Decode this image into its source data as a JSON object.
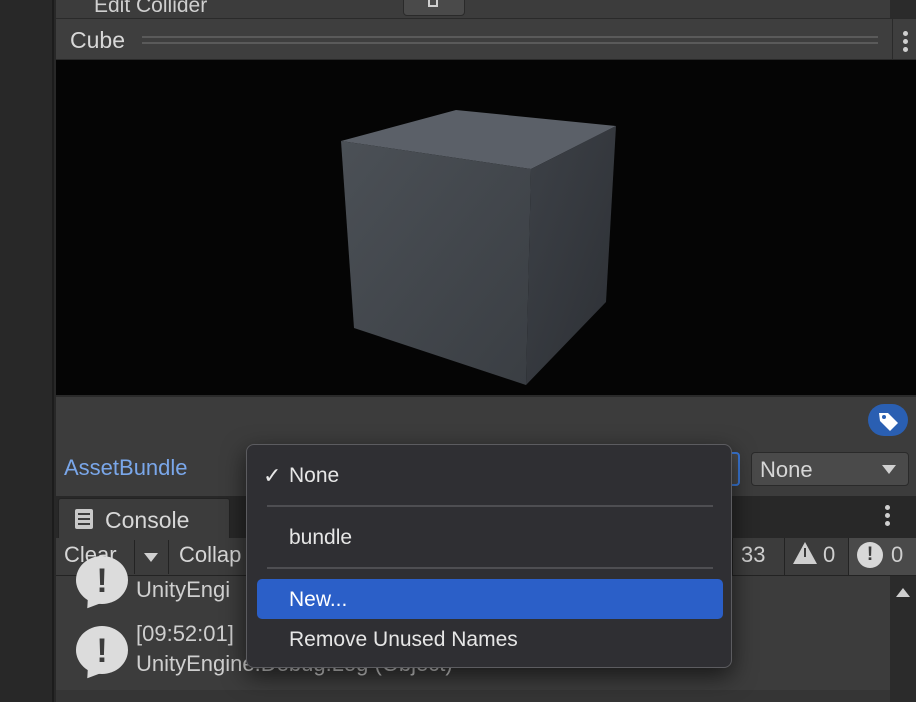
{
  "edit_collider": {
    "label": "Edit Collider"
  },
  "preview_header": {
    "title": "Cube"
  },
  "asset_bundle": {
    "label": "AssetBundle",
    "variant_value": "None"
  },
  "dropdown_menu": {
    "items": [
      {
        "label": "None",
        "checked": true,
        "check_glyph": "✓"
      },
      {
        "label": "bundle"
      },
      {
        "label": "New...",
        "highlighted": true
      },
      {
        "label": "Remove Unused Names"
      }
    ]
  },
  "console": {
    "tab_label": "Console",
    "toolbar": {
      "clear_label": "Clear",
      "collapse_label": "Collap",
      "log_count": "33",
      "warning_count": "0",
      "error_count": "0"
    },
    "entries": [
      {
        "line1": "UnityEngi"
      },
      {
        "line1": "[09:52:01]",
        "line2": "UnityEngine.Debug.Log (Object)"
      }
    ]
  },
  "colors": {
    "accent": "#2b5fc8",
    "asset_label": "#7aa7ea",
    "tag_badge": "#2a5fb2"
  }
}
